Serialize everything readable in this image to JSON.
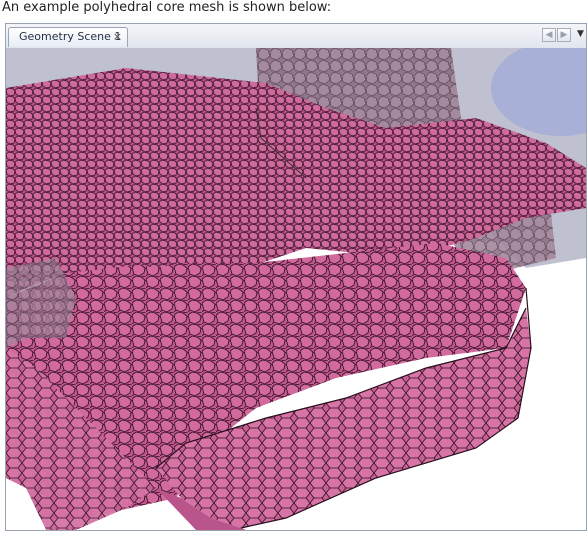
{
  "caption": "An example polyhedral core mesh is shown below:",
  "window": {
    "tab_label": "Geometry Scene 1",
    "tab_close": "×"
  },
  "icons": {
    "prev": "triangle-left-icon",
    "next": "triangle-right-icon",
    "menu": "chevron-down-icon"
  },
  "colors": {
    "mesh_fill": "#c4578e",
    "mesh_edge": "#2a0f1e",
    "shaded_surface": "#a7a9bd",
    "background_blue": "#a9b0d8"
  }
}
